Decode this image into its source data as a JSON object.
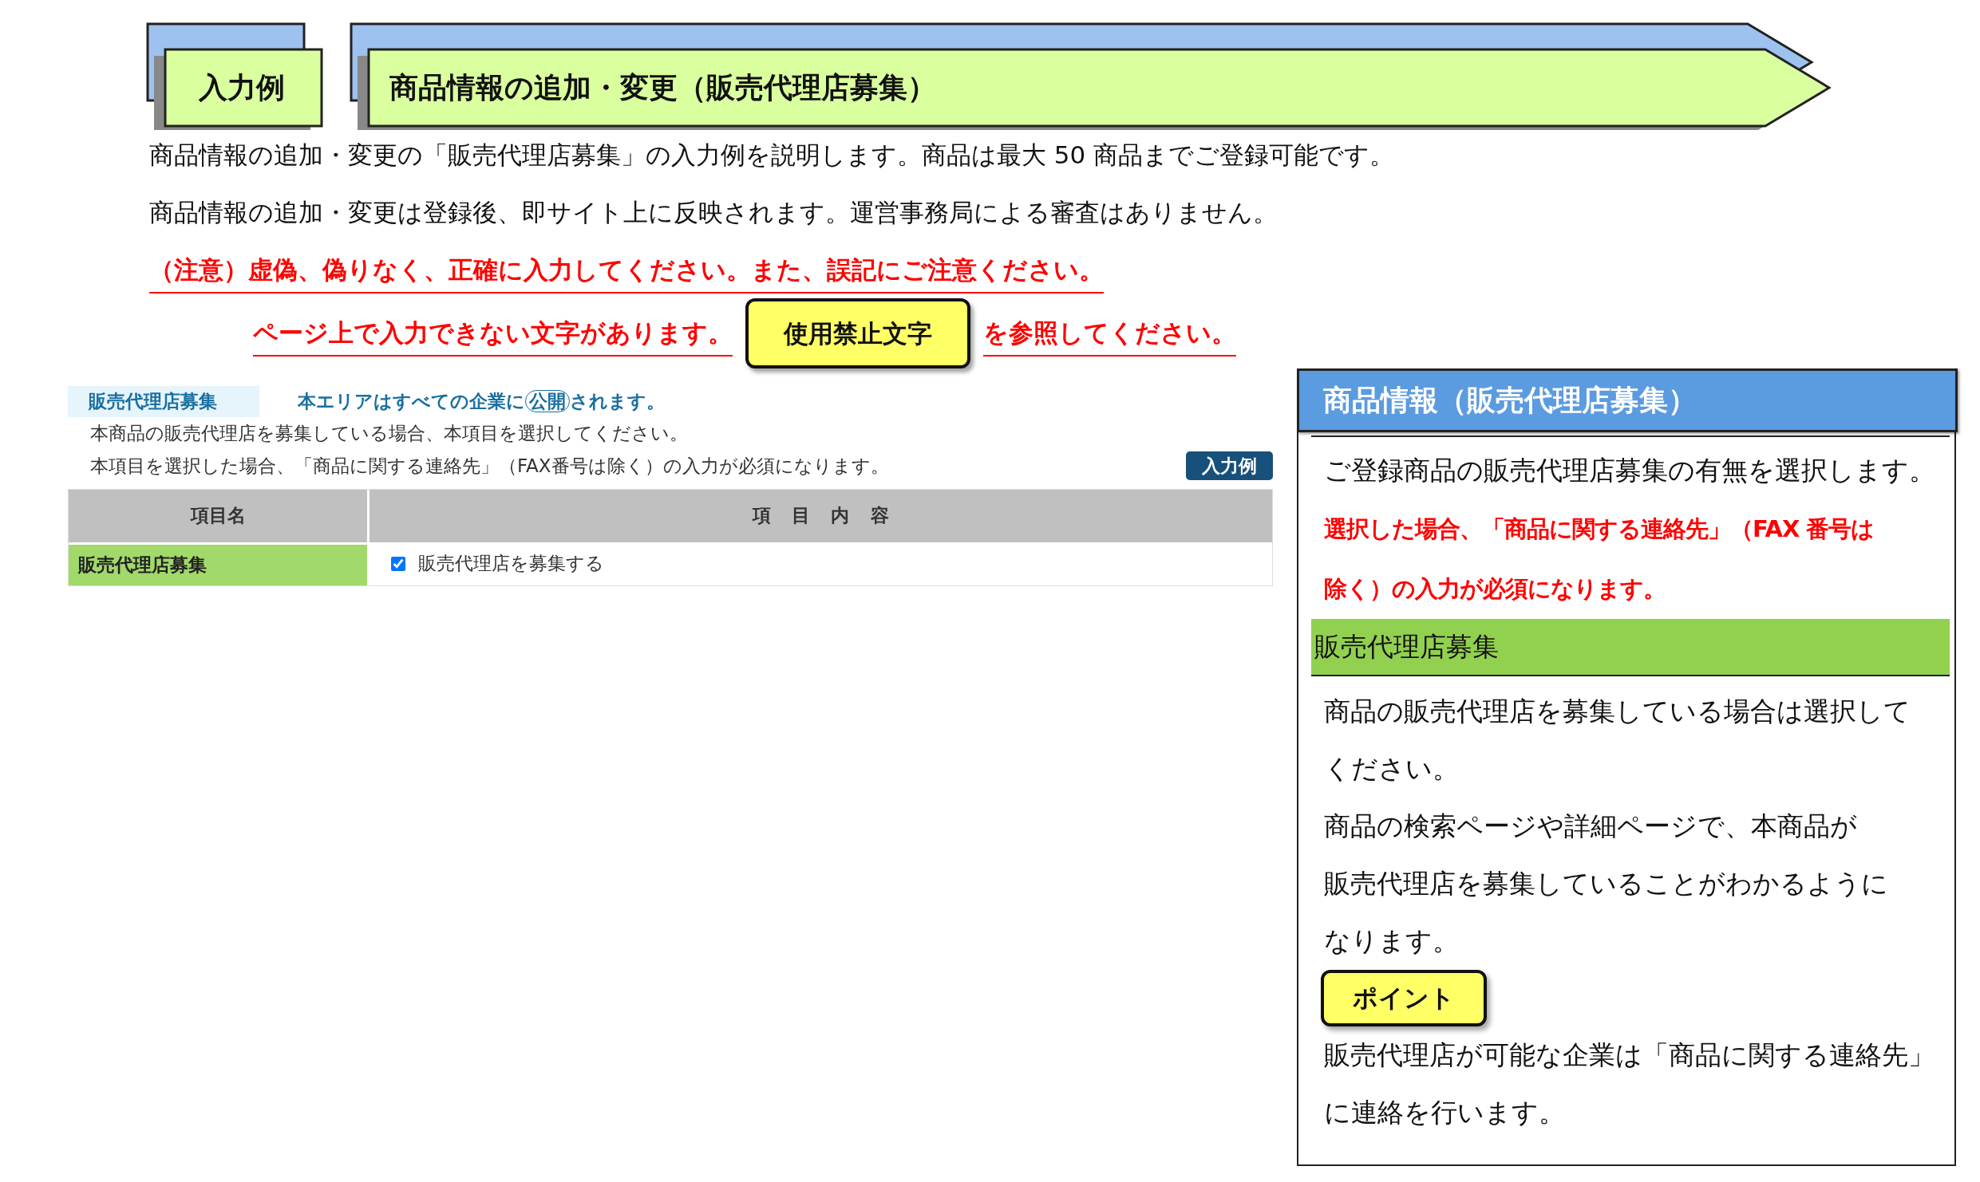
{
  "banner": {
    "tab": "入力例",
    "title": "商品情報の追加・変更（販売代理店募集）"
  },
  "intro": [
    "商品情報の追加・変更の「販売代理店募集」の入力例を説明します。商品は最大 50 商品までご登録可能です。",
    "商品情報の追加・変更は登録後、即サイト上に反映されます。運営事務局による審査はありません。"
  ],
  "caution": "（注意）虚偽、偽りなく、正確に入力してください。また、誤記にご注意ください。",
  "forbidden": {
    "before": "ページ上で入力できない文字があります。",
    "button": "使用禁止文字",
    "after": "を参照してください。"
  },
  "form": {
    "section_label": "販売代理店募集",
    "visibility": {
      "before": "本エリアはすべての企業に",
      "badge": "公開",
      "after": "されます。"
    },
    "descriptions": [
      "本商品の販売代理店を募集している場合、本項目を選択してください。",
      "本項目を選択した場合、「商品に関する連絡先」（FAX番号は除く）の入力が必須になります。"
    ],
    "example_button": "入力例",
    "table": {
      "columns": [
        "項目名",
        "項 目 内 容"
      ],
      "rows": [
        {
          "label": "販売代理店募集",
          "checkbox": {
            "label": "販売代理店を募集する",
            "checked": true
          }
        }
      ]
    }
  },
  "help_panel": {
    "title": "商品情報（販売代理店募集）",
    "blocks": [
      {
        "kind": "text",
        "lines": [
          "ご登録商品の販売代理店募集の有無を選択します。"
        ]
      },
      {
        "kind": "alert",
        "lines": [
          "選択した場合、「商品に関する連絡先」（FAX 番号は",
          "除く）の入力が必須になります。"
        ]
      },
      {
        "kind": "heading",
        "lines": [
          "販売代理店募集"
        ]
      },
      {
        "kind": "text",
        "lines": [
          "商品の販売代理店を募集している場合は選択して",
          "ください。",
          "商品の検索ページや詳細ページで、本商品が",
          "販売代理店を募集していることがわかるように",
          "なります。"
        ]
      },
      {
        "kind": "point",
        "lines": [
          "ポイント"
        ]
      },
      {
        "kind": "text",
        "lines": [
          "販売代理店が可能な企業は「商品に関する連絡先」",
          "に連絡を行います。"
        ]
      }
    ]
  }
}
